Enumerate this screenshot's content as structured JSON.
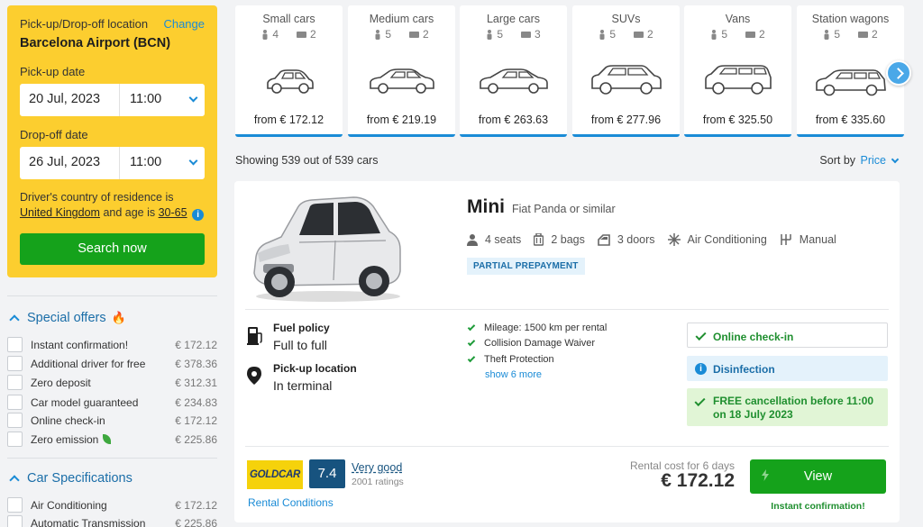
{
  "search": {
    "location_label": "Pick-up/Drop-off location",
    "change_label": "Change",
    "location_value": "Barcelona Airport (BCN)",
    "pickup_label": "Pick-up date",
    "pickup_date": "20 Jul, 2023",
    "pickup_time": "11:00",
    "dropoff_label": "Drop-off date",
    "dropoff_date": "26 Jul, 2023",
    "dropoff_time": "11:00",
    "residence_text": "Driver's country of residence is",
    "residence_country": "United Kingdom",
    "age_text": "and age is",
    "age_value": "30-65",
    "search_button": "Search now"
  },
  "filters": {
    "special_offers": {
      "title": "Special offers",
      "items": [
        {
          "label": "Instant confirmation!",
          "price": "€ 172.12"
        },
        {
          "label": "Additional driver for free",
          "price": "€ 378.36"
        },
        {
          "label": "Zero deposit",
          "price": "€ 312.31"
        },
        {
          "label": "Car model guaranteed",
          "price": "€ 234.83"
        },
        {
          "label": "Online check-in",
          "price": "€ 172.12"
        },
        {
          "label": "Zero emission",
          "price": "€ 225.86"
        }
      ]
    },
    "car_specs": {
      "title": "Car Specifications",
      "items": [
        {
          "label": "Air Conditioning",
          "price": "€ 172.12"
        },
        {
          "label": "Automatic Transmission",
          "price": "€ 225.86"
        }
      ]
    }
  },
  "categories": [
    {
      "name": "Small cars",
      "seats": "4",
      "bags": "2",
      "price": "from € 172.12"
    },
    {
      "name": "Medium cars",
      "seats": "5",
      "bags": "2",
      "price": "from € 219.19"
    },
    {
      "name": "Large cars",
      "seats": "5",
      "bags": "3",
      "price": "from € 263.63"
    },
    {
      "name": "SUVs",
      "seats": "5",
      "bags": "2",
      "price": "from € 277.96"
    },
    {
      "name": "Vans",
      "seats": "5",
      "bags": "2",
      "price": "from € 325.50"
    },
    {
      "name": "Station wagons",
      "seats": "5",
      "bags": "2",
      "price": "from € 335.60"
    }
  ],
  "results_header": {
    "showing": "Showing 539 out of 539 cars",
    "sort_label": "Sort by",
    "sort_value": "Price"
  },
  "result": {
    "category": "Mini",
    "model": "Fiat Panda or similar",
    "specs": {
      "seats": "4 seats",
      "bags": "2 bags",
      "doors": "3 doors",
      "ac": "Air Conditioning",
      "transmission": "Manual"
    },
    "prepayment_badge": "PARTIAL PREPAYMENT",
    "fuel_policy_label": "Fuel policy",
    "fuel_policy_value": "Full to full",
    "pickup_location_label": "Pick-up location",
    "pickup_location_value": "In terminal",
    "inclusions": [
      "Mileage: 1500 km per rental",
      "Collision Damage Waiver",
      "Theft Protection"
    ],
    "show_more": "show 6 more",
    "badges": {
      "checkin": "Online check-in",
      "disinfection": "Disinfection",
      "free_cancel": "FREE cancellation before 11:00 on 18 July 2023"
    },
    "supplier": "GOLDCAR",
    "score": "7.4",
    "rating_label": "Very good",
    "rating_count": "2001 ratings",
    "rental_conditions": "Rental Conditions",
    "rental_cost_label": "Rental cost for 6 days",
    "price": "€ 172.12",
    "view_button": "View",
    "instant_confirmation": "Instant confirmation!"
  },
  "colors": {
    "panel_yellow": "#fcce2f",
    "action_green": "#15a21b",
    "link_blue": "#1a8bd6",
    "navy": "#17537f"
  }
}
